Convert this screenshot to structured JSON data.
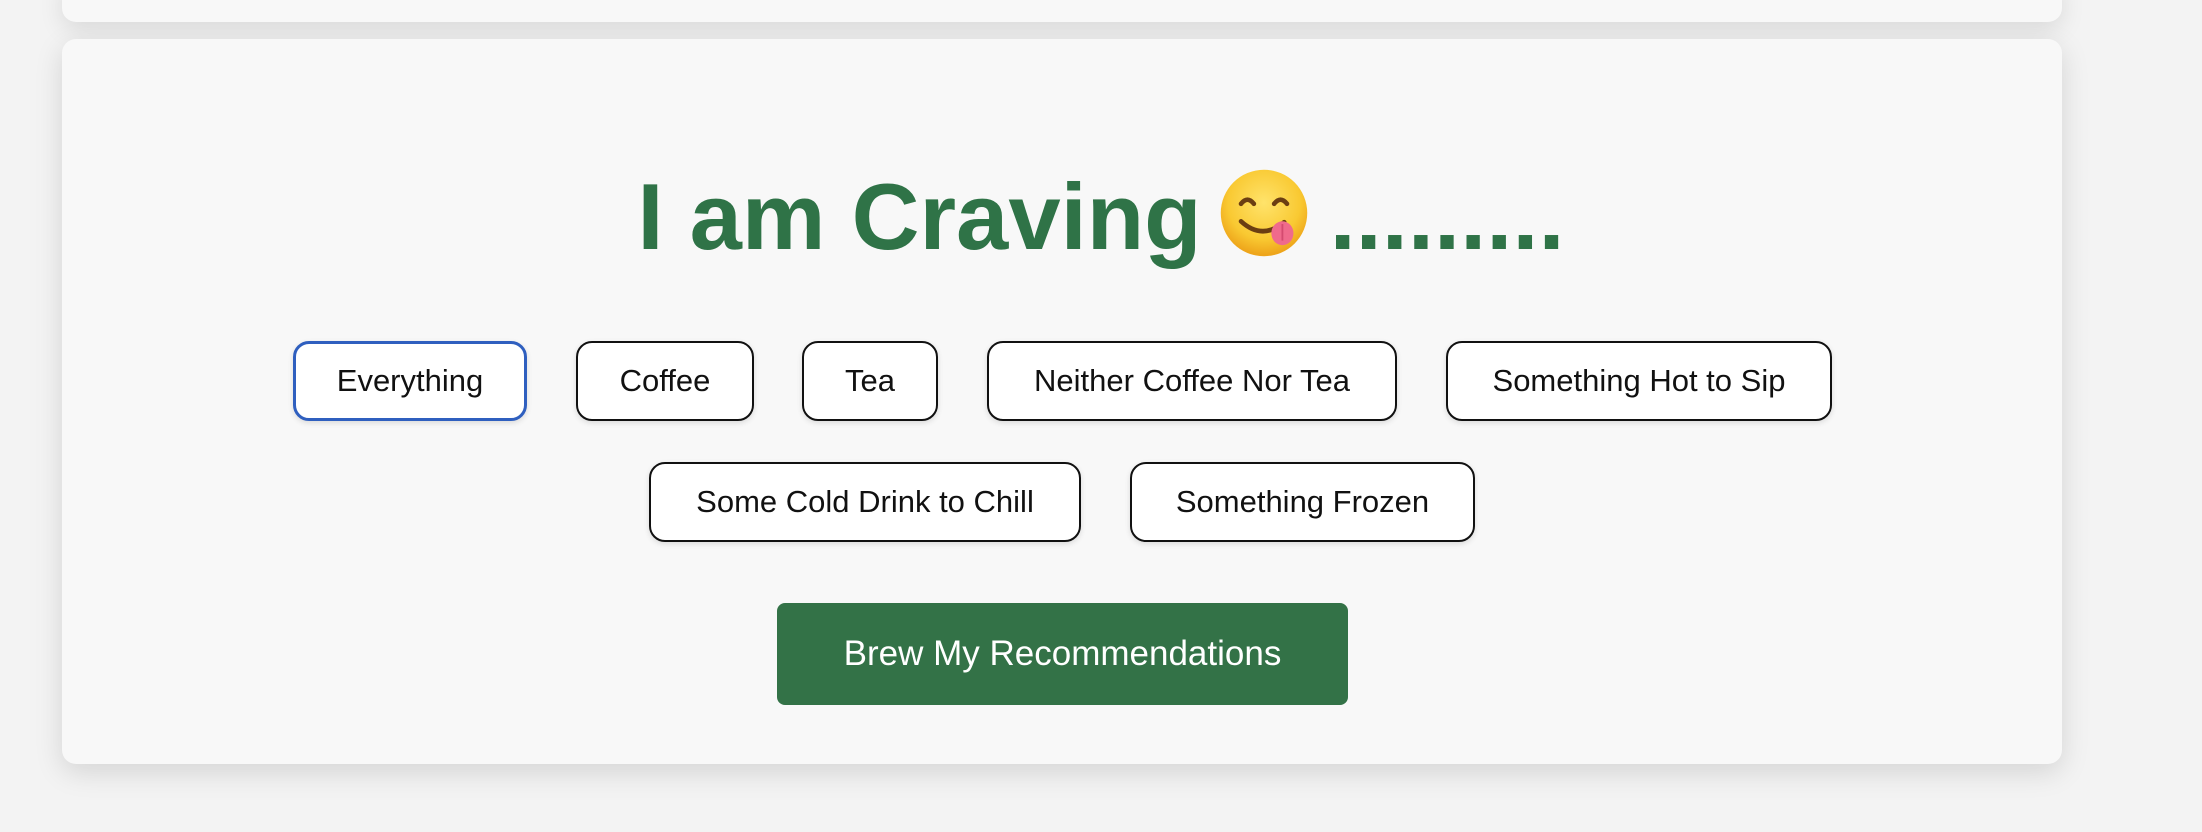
{
  "heading": {
    "prefix": "I am Craving",
    "emoji": "savoring-food-face-icon",
    "suffix": "........."
  },
  "options": [
    {
      "label": "Everything",
      "selected": true
    },
    {
      "label": "Coffee",
      "selected": false
    },
    {
      "label": "Tea",
      "selected": false
    },
    {
      "label": "Neither Coffee Nor Tea",
      "selected": false
    },
    {
      "label": "Something Hot to Sip",
      "selected": false
    },
    {
      "label": "Some Cold Drink to Chill",
      "selected": false
    },
    {
      "label": "Something Frozen",
      "selected": false
    }
  ],
  "actions": {
    "brew_label": "Brew My Recommendations"
  },
  "colors": {
    "brand_green": "#2f7347",
    "button_green": "#337247",
    "selected_border": "#2f5fbf"
  }
}
